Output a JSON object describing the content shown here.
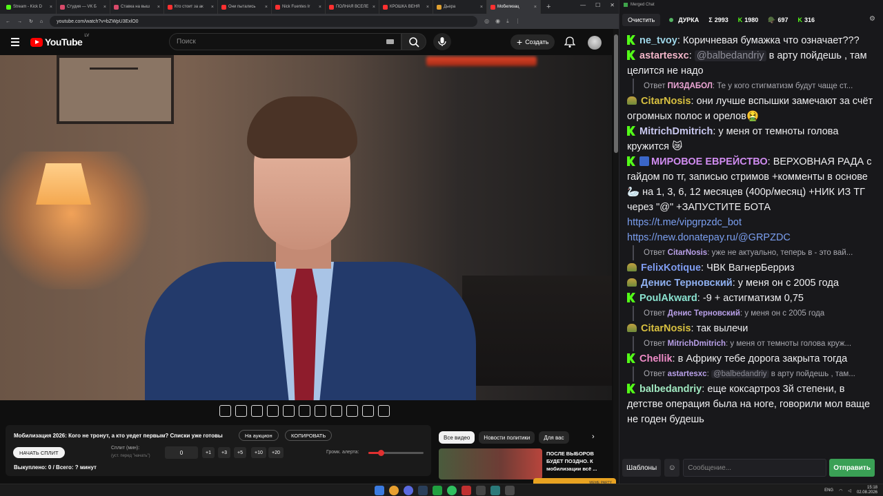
{
  "browser": {
    "tabs": [
      {
        "title": "Stream - Kick D",
        "color": "#53fc18"
      },
      {
        "title": "Студия — VK Б",
        "color": "#d94a6a"
      },
      {
        "title": "Ставка на выш",
        "color": "#d94a6a"
      },
      {
        "title": "Кто стоит за ак",
        "color": "#ff3030"
      },
      {
        "title": "Они пытались",
        "color": "#ff3030"
      },
      {
        "title": "Nick Fuentes Ir",
        "color": "#ff3030"
      },
      {
        "title": "ПОЛНАЯ ВСЕЛЕ",
        "color": "#ff3030"
      },
      {
        "title": "КРОШКА ВЕНЯ",
        "color": "#ff3030"
      },
      {
        "title": "Дьера",
        "color": "#e0a030"
      },
      {
        "title": "Мобилизац",
        "color": "#ff3030"
      }
    ],
    "url": "youtube.com/watch?v=bZWpU3ExlO0"
  },
  "youtube": {
    "logo": "YouTube",
    "region": "LV",
    "search_placeholder": "Поиск",
    "create_label": "Создать"
  },
  "panel": {
    "title": "Мобилизация 2026: Кого не тронут, а кто уедет первым? Списки уже готовы",
    "auction_btn": "На аукцион",
    "copy_btn": "КОПИРОВАТЬ",
    "start_split": "НАЧАТЬ СПЛИТ",
    "split_label": "Сплит (мин):",
    "split_hint": "(уст. перед \"начать\")",
    "split_value": "0",
    "steps": [
      "+1",
      "+3",
      "+5",
      "+10",
      "+20"
    ],
    "alert_volume_label": "Громк. алерта:",
    "alert_volume_level": 0.22,
    "bought": "Выкуплено: 0 / Всего: ? минут"
  },
  "recommend": {
    "chips": [
      "Все видео",
      "Новости политики",
      "Для вас"
    ],
    "video_title": "ПОСЛЕ ВЫБОРОВ БУДЕТ ПОЗДНО. К мобилизации всё ...",
    "video_badge": "MEME PARTY"
  },
  "taskbar": {
    "lang": "ENG",
    "time": "15:18",
    "date": "02.08.2026"
  },
  "chat": {
    "window_title": "Merged Chat",
    "clear": "Очистить",
    "channel": "ДУРКА",
    "stats": [
      {
        "icon": "Σ",
        "value": "2993"
      },
      {
        "icon": "K",
        "value": "1980"
      },
      {
        "icon": "🪖",
        "value": "697"
      },
      {
        "icon": "K",
        "value": "316"
      }
    ],
    "messages": [
      {
        "badge": "kick",
        "nick": "ne_tvoy",
        "color": "#9fd6e8",
        "text": "Коричневая бумажка что означает???"
      },
      {
        "badge": "kick",
        "nick": "astartesxc",
        "color": "#f2b5c8",
        "mention": "@balbedandriy",
        "text": " в арту пойдешь , там целится не надо"
      },
      {
        "reply": true,
        "rnick": "ПИЗДАБОЛ",
        "rcolor": "#f0a8d8",
        "text": "Те у кого стигматизм будут чаще ст..."
      },
      {
        "badge": "vk",
        "nick": "CitarNosis",
        "color": "#d8c040",
        "text": "они лучше вспышки замечают за счёт огромных полос и орелов🤮"
      },
      {
        "badge": "kick",
        "nick": "MitrichDmitrich",
        "color": "#c9c8f0",
        "text": "у меня от темноты голова кружится 😿"
      },
      {
        "badge": "kick",
        "badge_extra": true,
        "nick": "МИРОВОЕ ЕВРЕЙСТВО",
        "color": "#d08cf0",
        "text": "ВЕРХОВНАЯ РАДА с гайдом по тг, записью стримов +комменты в основе 🦢 на 1, 3, 6, 12 месяцев (400р/месяц) +НИК ИЗ ТГ через \"@\" +ЗАПУСТИТЕ БОТА",
        "links": [
          "https://t.me/vipgrpzdc_bot",
          "https://new.donatepay.ru/@GRPZDC"
        ]
      },
      {
        "reply": true,
        "rnick": "CitarNosis",
        "rcolor": "#b9a0e8",
        "text": "уже не актуально, теперь в - это вай..."
      },
      {
        "badge": "vk",
        "nick": "FelixKotique",
        "color": "#7f9cf0",
        "text": "ЧВК ВагнерБерриз"
      },
      {
        "badge": "vk",
        "nick": "Денис Терновский",
        "color": "#8fb0f0",
        "text": "у меня он с 2005 года"
      },
      {
        "badge": "kick",
        "nick": "PoulAkward",
        "color": "#8ae2d0",
        "text": "-9 + астигматизм 0,75"
      },
      {
        "reply": true,
        "rnick": "Денис Терновский",
        "rcolor": "#b9a0e8",
        "text": "у меня он с 2005 года"
      },
      {
        "badge": "vk",
        "nick": "CitarNosis",
        "color": "#d8c040",
        "text": "так вылечи"
      },
      {
        "reply": true,
        "rnick": "MitrichDmitrich",
        "rcolor": "#b9a0e8",
        "text": "у меня от темноты голова круж..."
      },
      {
        "badge": "kick",
        "nick": "Chellik",
        "color": "#f08cc8",
        "text": "в Африку тебе дорога закрыта тогда"
      },
      {
        "reply": true,
        "rnick": "astartesxc",
        "rcolor": "#b9a0e8",
        "mention": "@balbedandriy",
        "text": " в арту пойдешь , там..."
      },
      {
        "badge": "kick",
        "nick": "balbedandriy",
        "color": "#a0e8c0",
        "text": "еще коксартроз 3й степени, в детстве операция была на ноге, говорили мол ваще не годен будешь"
      }
    ],
    "templates_btn": "Шаблоны",
    "message_placeholder": "Сообщение...",
    "send_btn": "Отправить"
  }
}
